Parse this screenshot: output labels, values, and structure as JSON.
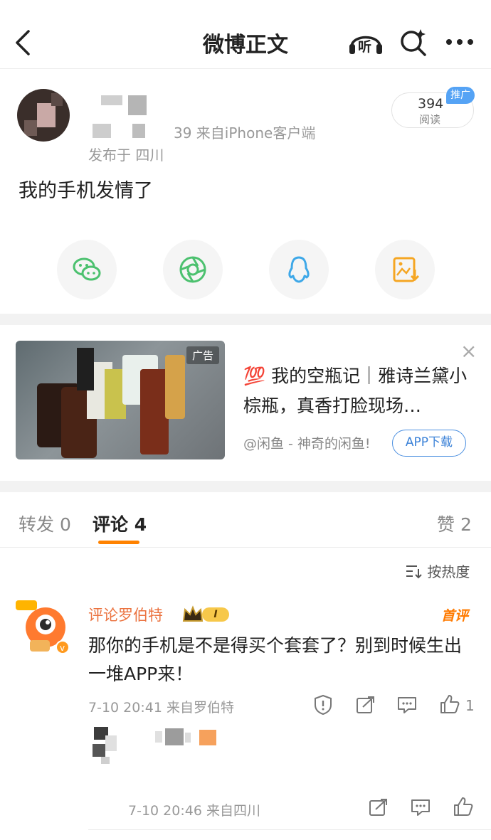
{
  "nav": {
    "title": "微博正文",
    "listen_label": "听"
  },
  "post": {
    "meta": "39  来自iPhone客户端",
    "location": "发布于 四川",
    "read_count": "394",
    "read_label": "阅读",
    "promo_tag": "推广",
    "text": "我的手机发情了"
  },
  "share": {
    "icons": [
      "wechat-icon",
      "moments-icon",
      "qq-icon",
      "save-image-icon"
    ]
  },
  "ad": {
    "tag": "广告",
    "title_emoji": "💯",
    "title": "我的空瓶记｜雅诗兰黛小棕瓶，真香打脸现场…",
    "source": "@闲鱼 - 神奇的闲鱼!",
    "button": "APP下载",
    "close": "×"
  },
  "tabs": [
    {
      "label": "转发 0"
    },
    {
      "label": "评论 4"
    },
    {
      "label": "赞 2"
    }
  ],
  "sort_label": "按热度",
  "comments": [
    {
      "name": "评论罗伯特",
      "badge_level": "I",
      "first_tag": "首评",
      "text": "那你的手机是不是得买个套套了？别到时候生出一堆APP来！",
      "time": "7-10 20:41 来自罗伯特",
      "like_count": "1"
    },
    {
      "time": "7-10 20:46 来自四川"
    }
  ],
  "colors": {
    "accent_orange": "#ff8200",
    "link_blue": "#3b82d8",
    "name_orange": "#eb7340",
    "wechat_green": "#4cc16f",
    "moments_green": "#4cc16f",
    "qq_blue": "#3ea8e8",
    "save_orange": "#f5a623"
  }
}
